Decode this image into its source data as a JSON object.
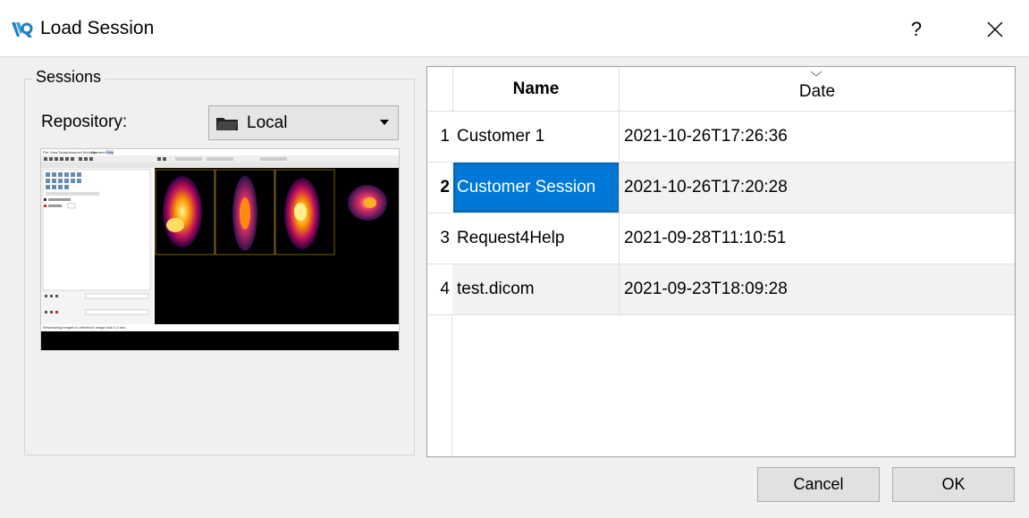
{
  "window": {
    "title": "Load Session",
    "help_label": "?",
    "close_icon": "close-icon",
    "app_icon": "voreen-logo-icon"
  },
  "sessions_group": {
    "title": "Sessions",
    "repository_label": "Repository:",
    "repository_value": "Local",
    "repository_icon": "folder-icon"
  },
  "preview": {
    "menu_items": [
      "File",
      "View",
      "Tools",
      "Advanced Modules",
      "Operator",
      "Help"
    ],
    "status_text": "Resampling images to reference image took 0.2 sec"
  },
  "table": {
    "columns": [
      "Name",
      "Date"
    ],
    "sorted_column": "Date",
    "rows": [
      {
        "num": "1",
        "name": "Customer 1",
        "date": "2021-10-26T17:26:36"
      },
      {
        "num": "2",
        "name": "Customer Session",
        "date": "2021-10-26T17:20:28",
        "selected": true
      },
      {
        "num": "3",
        "name": "Request4Help",
        "date": "2021-09-28T11:10:51"
      },
      {
        "num": "4",
        "name": "test.dicom",
        "date": "2021-09-23T18:09:28"
      }
    ]
  },
  "buttons": {
    "cancel": "Cancel",
    "ok": "OK"
  },
  "colors": {
    "selection": "#0078d7",
    "dialog_bg": "#f0f0f0"
  }
}
